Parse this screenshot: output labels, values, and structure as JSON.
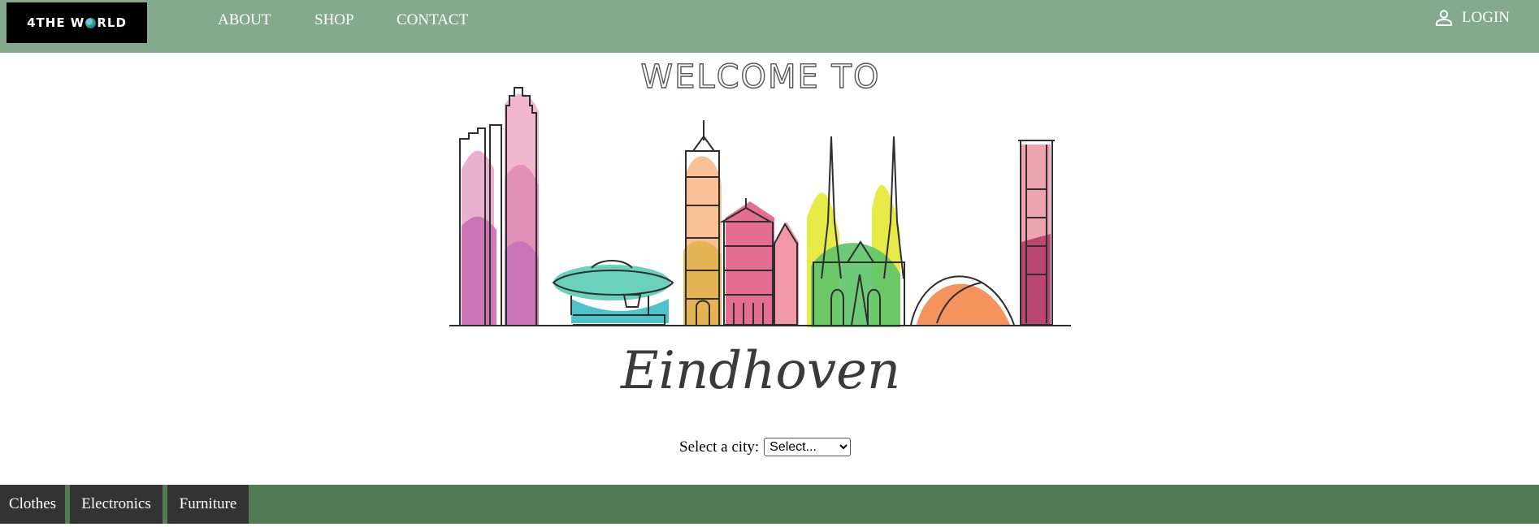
{
  "header": {
    "logo_text_left": "4THE W",
    "logo_text_right": "RLD",
    "nav": {
      "about": "ABOUT",
      "shop": "SHOP",
      "contact": "CONTACT"
    },
    "login_label": "LOGIN"
  },
  "hero": {
    "welcome": "WELCOME TO",
    "city_name": "Eindhoven"
  },
  "city_select": {
    "label": "Select a city:",
    "selected": "Select..."
  },
  "categories": {
    "clothes": "Clothes",
    "electronics": "Electronics",
    "furniture": "Furniture"
  },
  "colors": {
    "nav_bg": "#84a98c",
    "category_bar_bg": "#537b53",
    "category_tab_bg": "#333333"
  }
}
